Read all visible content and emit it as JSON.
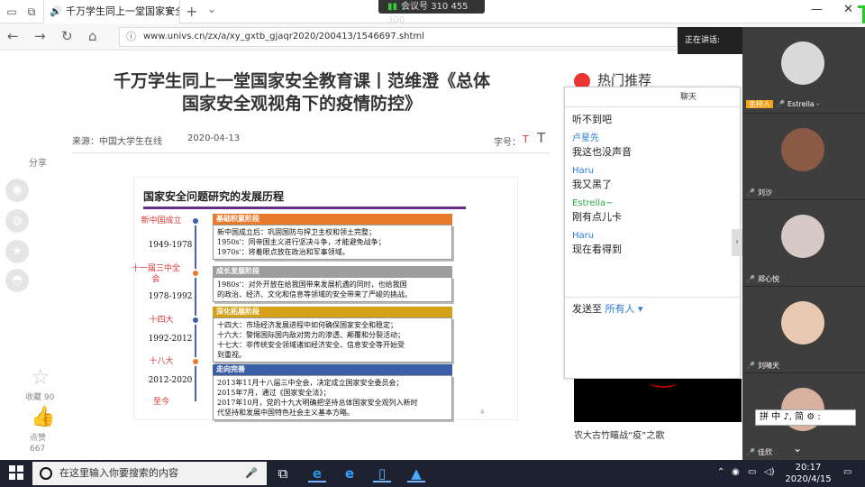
{
  "browser": {
    "tab_title": "千万学生同上一堂国家安全",
    "meeting_id": "会议号 310 455 300",
    "url": "www.univs.cn/zx/a/xy_gxtb_gjaqr2020/200413/1546697.shtml",
    "speaking_label": "正在讲话:"
  },
  "article": {
    "title_line1": "千万学生同上一堂国家安全教育课丨范维澄《总体",
    "title_line2": "国家安全观视角下的疫情防控》",
    "source": "来源：中国大学生在线",
    "date": "2020-04-13",
    "font_label": "字号：",
    "font_small": "T",
    "font_large": "T"
  },
  "share": {
    "label": "分享",
    "icons": [
      "weibo-icon",
      "wechat-icon",
      "qzone-icon",
      "qq-icon"
    ],
    "collect": "收藏 90",
    "like_label": "点赞",
    "like_count": "667"
  },
  "slide": {
    "title": "国家安全问题研究的发展历程",
    "stages": [
      {
        "event": "新中国成立",
        "years": "1949-1978",
        "color": "#e87a2c",
        "dot": "#3a5ea8",
        "heading": "基础积累阶段",
        "lines": [
          "新中国成立后：巩固国防与捍卫主权和领土完整；",
          "1950s'：同帝国主义进行坚决斗争，才能避免战争；",
          "1970s'：将着眼点放在政治和军事领域。"
        ]
      },
      {
        "event": "十一届三中全会",
        "years": "1978-1992",
        "color": "#9e9e9e",
        "dot": "#e87a2c",
        "heading": "成长发展阶段",
        "lines": [
          "1980s'：对外开放在给我国带来发展机遇的同时，也给我国",
          "的政治、经济、文化和信息等领域的安全带来了严峻的挑战。"
        ]
      },
      {
        "event": "十四大",
        "years": "1992-2012",
        "color": "#d4a017",
        "dot": "#3a5ea8",
        "heading": "深化拓展阶段",
        "lines": [
          "十四大：市场经济发展进程中如何确保国家安全和稳定；",
          "十六大：警惕国际国内敌对势力的渗透、颠覆和分裂活动；",
          "十七大：非传统安全领域诸如经济安全、信息安全等开始受",
          "到重视。"
        ]
      },
      {
        "event": "十八大",
        "years": "2012-2020",
        "color": "#3a5ea8",
        "dot": "#e87a2c",
        "heading": "走向完善",
        "lines": [
          "2013年11月十八届三中全会，决定成立国家安全委员会；",
          "2015年7月，通过《国家安全法》；",
          "2017年10月，党的十九大明确把坚持总体国家安全观列入新时",
          "代坚持和发展中国特色社会主义基本方略。"
        ]
      }
    ],
    "now_label": "至今",
    "page_no": "4"
  },
  "hot": {
    "title": "热门推荐",
    "caption": "农大古竹瞄战“疫”之歌"
  },
  "chat": {
    "header": "聊天",
    "messages": [
      {
        "name": "",
        "text": "听不到吧"
      },
      {
        "name": "卢星先",
        "text": "我这也没声音"
      },
      {
        "name": "Haru",
        "text": "我又黑了"
      },
      {
        "name": "Estrella~",
        "text": "刚有点儿卡"
      },
      {
        "name": "Haru",
        "text": "现在看得到"
      }
    ],
    "send_to_label": "发送至",
    "send_to_value": "所有人"
  },
  "video": {
    "host_badge": "主持人",
    "tiles": [
      {
        "name": "Estrella -",
        "host": true,
        "color": "#d9d9d9"
      },
      {
        "name": "刘沙",
        "host": false,
        "color": "#8a5a44"
      },
      {
        "name": "郑心悦",
        "host": false,
        "color": "#d7c9c6"
      },
      {
        "name": "刘晴天",
        "host": false,
        "color": "#e8c8b0"
      },
      {
        "name": "佳欣",
        "host": false,
        "color": "#d8b0a0"
      }
    ],
    "ime": "拼 中 ♪, 简 ⚙ :"
  },
  "taskbar": {
    "search_placeholder": "在这里输入你要搜索的内容",
    "time": "20:17",
    "date": "2020/4/15"
  }
}
